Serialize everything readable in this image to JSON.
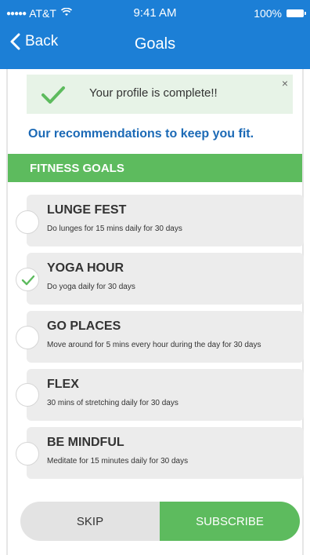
{
  "status_bar": {
    "carrier": "AT&T",
    "time": "9:41 AM",
    "battery": "100%"
  },
  "nav": {
    "back_label": "Back",
    "title": "Goals"
  },
  "alert": {
    "message": "Your profile is complete!!",
    "close": "×"
  },
  "recommendation": "Our recommendations to keep you fit.",
  "section_title": "FITNESS GOALS",
  "goals": [
    {
      "name": "LUNGE FEST",
      "description": "Do lunges for 15 mins daily for 30 days",
      "selected": false
    },
    {
      "name": "YOGA HOUR",
      "description": "Do yoga daily for 30 days",
      "selected": true
    },
    {
      "name": "GO PLACES",
      "description": "Move around for 5 mins every hour during the day for 30 days",
      "selected": false
    },
    {
      "name": "FLEX",
      "description": "30 mins of stretching daily for 30 days",
      "selected": false
    },
    {
      "name": "BE MINDFUL",
      "description": "Meditate for 15 minutes daily for 30 days",
      "selected": false
    }
  ],
  "buttons": {
    "skip": "SKIP",
    "subscribe": "SUBSCRIBE"
  },
  "colors": {
    "header": "#1c7fd6",
    "accent_green": "#5dbb5e",
    "link_blue": "#1c6ab6",
    "card_gray": "#ececec"
  }
}
